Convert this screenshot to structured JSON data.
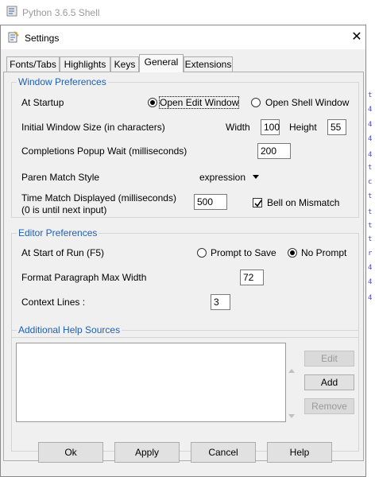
{
  "shell": {
    "title": "Python 3.6.5 Shell"
  },
  "dialog": {
    "title": "Settings",
    "close_glyph": "✕"
  },
  "tabs": [
    {
      "label": "Fonts/Tabs"
    },
    {
      "label": "Highlights"
    },
    {
      "label": "Keys"
    },
    {
      "label": "General",
      "active": true
    },
    {
      "label": "Extensions"
    }
  ],
  "window_prefs": {
    "title": "Window Preferences",
    "at_startup": {
      "label": "At Startup",
      "option_edit": "Open Edit Window",
      "option_shell": "Open Shell Window",
      "selected": "Open Edit Window"
    },
    "window_size": {
      "label": "Initial Window Size  (in characters)",
      "width_label": "Width",
      "width_value": "100",
      "height_label": "Height",
      "height_value": "55"
    },
    "completions": {
      "label": "Completions Popup Wait (milliseconds)",
      "value": "200"
    },
    "paren_style": {
      "label": "Paren Match Style",
      "value": "expression"
    },
    "time_match": {
      "label_line1": "Time Match Displayed (milliseconds)",
      "label_line2": "(0 is until next input)",
      "value": "500",
      "bell_label": "Bell on Mismatch",
      "bell_checked": true
    }
  },
  "editor_prefs": {
    "title": "Editor Preferences",
    "start_of_run": {
      "label": "At Start of Run (F5)",
      "option_prompt": "Prompt to Save",
      "option_noprompt": "No Prompt",
      "selected": "No Prompt"
    },
    "paragraph_width": {
      "label": "Format Paragraph Max Width",
      "value": "72"
    },
    "context_lines": {
      "label": "Context Lines :",
      "value": "3"
    }
  },
  "help_sources": {
    "title": "Additional Help Sources",
    "edit_label": "Edit",
    "add_label": "Add",
    "remove_label": "Remove"
  },
  "buttons": {
    "ok": "Ok",
    "apply": "Apply",
    "cancel": "Cancel",
    "help": "Help"
  },
  "shell_side_text": [
    "t",
    "4",
    "4",
    "4",
    "4",
    "t",
    "c",
    "t",
    "t",
    "t",
    "t",
    "r",
    "4",
    "4",
    "4",
    "4",
    "4",
    "4",
    "E"
  ],
  "colors": {
    "group_title": "#1e5fb4",
    "dialog_bg": "#f0f0f0"
  }
}
